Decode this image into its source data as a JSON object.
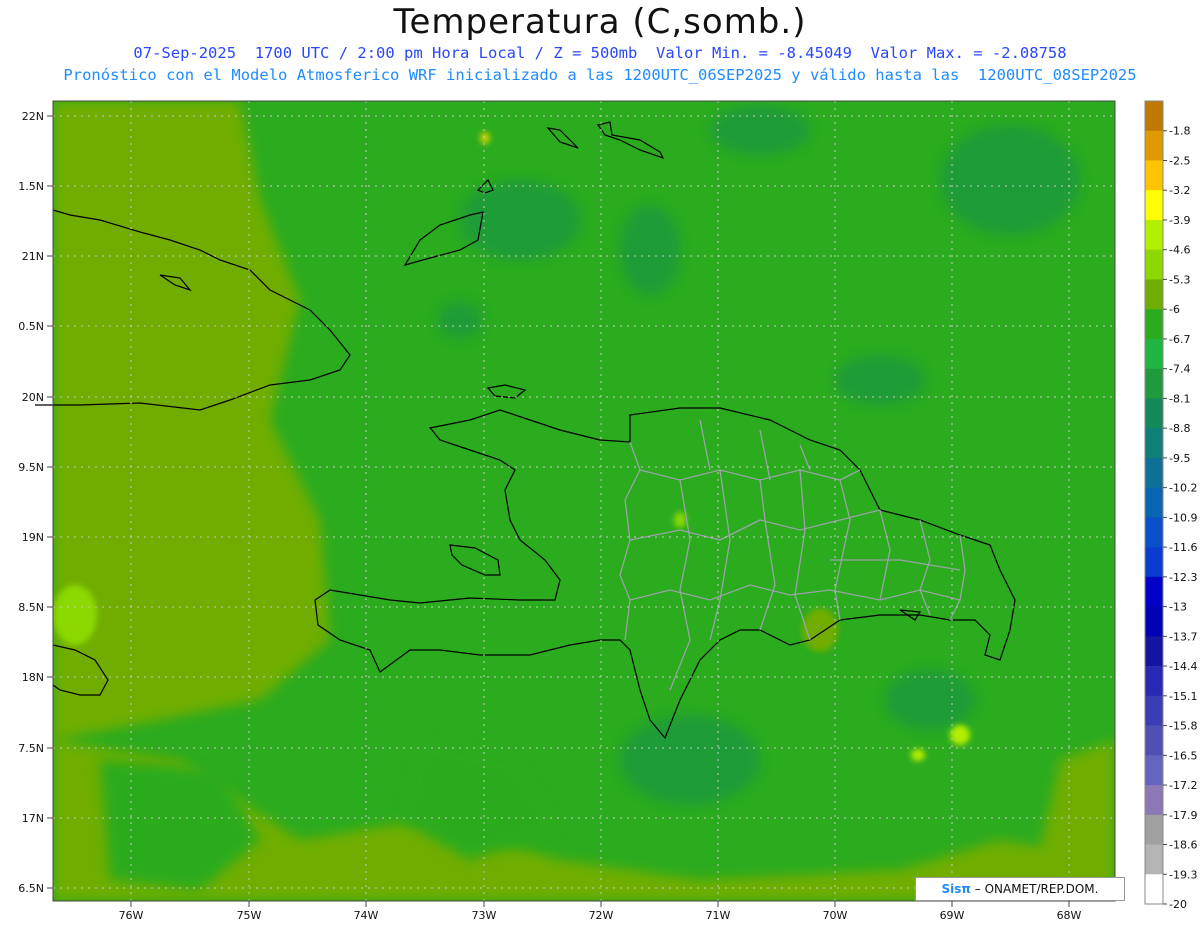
{
  "header": {
    "title": "Temperatura (C,somb.)",
    "line1": "07-Sep-2025  1700 UTC / 2:00 pm Hora Local / Z = 500mb  Valor Min. = -8.45049  Valor Max. = -2.08758",
    "line2": "Pronóstico con el Modelo Atmosferico WRF inicializado a las 1200UTC_06SEP2025 y válido hasta las  1200UTC_08SEP2025"
  },
  "map": {
    "lat_labels": [
      "22N",
      "1.5N",
      "21N",
      "0.5N",
      "20N",
      "9.5N",
      "19N",
      "8.5N",
      "18N",
      "7.5N",
      "17N",
      "6.5N"
    ],
    "lon_labels": [
      "76W",
      "75W",
      "74W",
      "73W",
      "72W",
      "71W",
      "70W",
      "69W",
      "68W"
    ],
    "grid_lines": "dotted",
    "field_colors": {
      "light": "#6fad00",
      "mid": "#2bab1e",
      "dark": "#1f9a3c",
      "spot": "#c8d200"
    }
  },
  "colorbar": {
    "labels": [
      "-1.8",
      "-2.5",
      "-3.2",
      "-3.9",
      "-4.6",
      "-5.3",
      "-6",
      "-6.7",
      "-7.4",
      "-8.1",
      "-8.8",
      "-9.5",
      "-10.2",
      "-10.9",
      "-11.6",
      "-12.3",
      "-13",
      "-13.7",
      "-14.4",
      "-15.1",
      "-15.8",
      "-16.5",
      "-17.2",
      "-17.9",
      "-18.6",
      "-19.3",
      "-20"
    ],
    "colors": [
      "#c07800",
      "#e09a00",
      "#ffc400",
      "#ffff00",
      "#b4ee00",
      "#8cd800",
      "#6fad00",
      "#2bab1e",
      "#20b440",
      "#1f9a3c",
      "#148a5a",
      "#0f8078",
      "#0f7096",
      "#0a64b4",
      "#0a50c8",
      "#0a3cd2",
      "#0000c8",
      "#0000b4",
      "#1414a0",
      "#2828b4",
      "#3c3cb4",
      "#5050b4",
      "#6464be",
      "#8c78b4",
      "#a0a0a0",
      "#b4b4b4",
      "#ffffff"
    ]
  },
  "credit": {
    "brand": "Sisπ",
    "text": "– ONAMET/REP.DOM."
  }
}
